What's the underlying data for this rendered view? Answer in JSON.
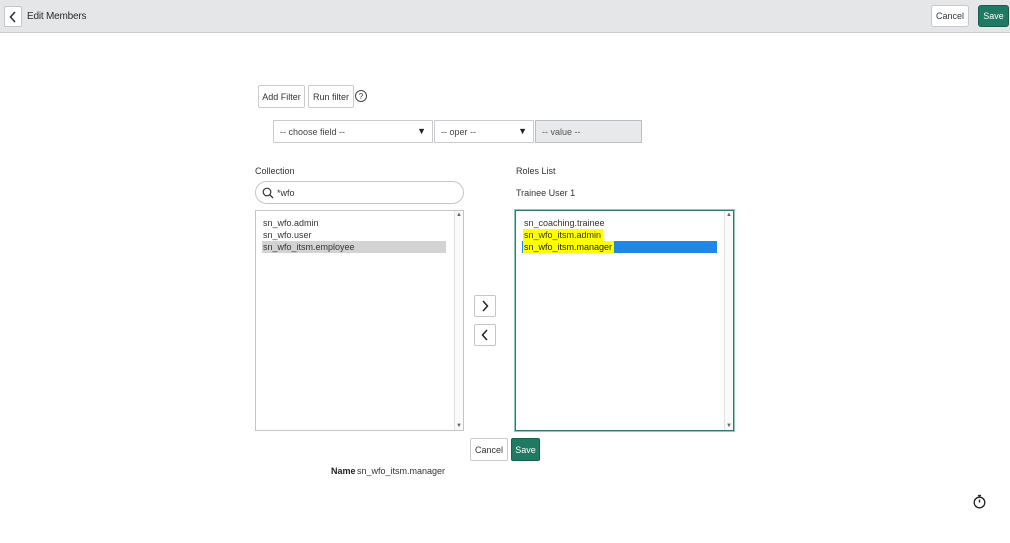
{
  "header": {
    "title": "Edit Members",
    "cancel_label": "Cancel",
    "save_label": "Save"
  },
  "filter": {
    "add_filter_label": "Add Filter",
    "run_filter_label": "Run filter",
    "help_icon": "question-icon",
    "field_placeholder": "-- choose field --",
    "oper_placeholder": "-- oper --",
    "value_placeholder": "-- value --"
  },
  "collection": {
    "label": "Collection",
    "search_value": "*wfo",
    "items": [
      {
        "label": "sn_wfo.admin",
        "selected": false
      },
      {
        "label": "sn_wfo.user",
        "selected": false
      },
      {
        "label": "sn_wfo_itsm.employee",
        "selected": true
      }
    ]
  },
  "roles": {
    "label": "Roles List",
    "user": "Trainee User 1",
    "items": [
      {
        "label": "sn_coaching.trainee",
        "highlight": false,
        "selected": false
      },
      {
        "label": "sn_wfo_itsm.admin",
        "highlight": true,
        "selected": false
      },
      {
        "label": "sn_wfo_itsm.manager",
        "highlight": true,
        "selected": true
      }
    ]
  },
  "actions": {
    "cancel_label": "Cancel",
    "save_label": "Save"
  },
  "name": {
    "label": "Name",
    "value": "sn_wfo_itsm.manager"
  },
  "colors": {
    "accent": "#1e7a63",
    "selection": "#1f87e5",
    "highlight": "#ffff00",
    "collection_selected": "#d3d3d3"
  }
}
